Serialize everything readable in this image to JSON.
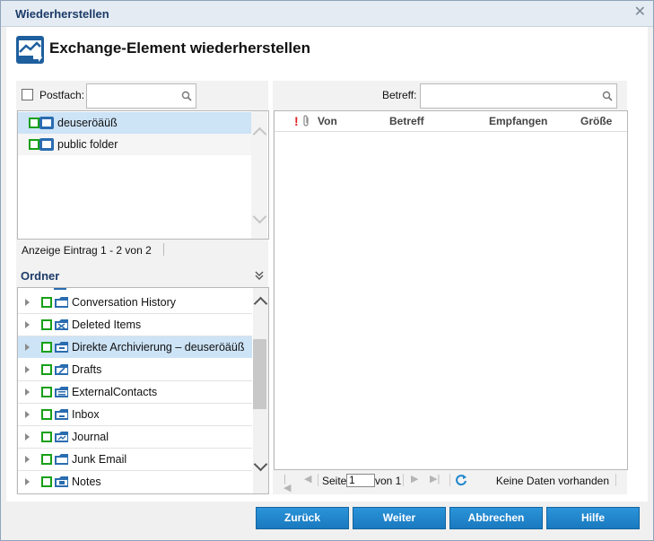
{
  "window": {
    "title": "Wiederherstellen"
  },
  "header": {
    "title": "Exchange-Element wiederherstellen"
  },
  "mailbox_filter": {
    "label": "Postfach:",
    "value": "",
    "placeholder": ""
  },
  "mailboxes": [
    {
      "label": "deuseröäüß",
      "selected": true
    },
    {
      "label": "public folder",
      "selected": false
    }
  ],
  "mailbox_status": "Anzeige Eintrag 1 - 2 von 2",
  "folders_section": {
    "title": "Ordner"
  },
  "folders": [
    {
      "label": "Conversation History",
      "icon": "folder-icon"
    },
    {
      "label": "Deleted Items",
      "icon": "deleted-folder-icon"
    },
    {
      "label": "Direkte Archivierung – deuseröäüß",
      "icon": "archive-folder-icon",
      "selected": true
    },
    {
      "label": "Drafts",
      "icon": "drafts-folder-icon"
    },
    {
      "label": "ExternalContacts",
      "icon": "contacts-folder-icon"
    },
    {
      "label": "Inbox",
      "icon": "inbox-folder-icon"
    },
    {
      "label": "Journal",
      "icon": "journal-folder-icon"
    },
    {
      "label": "Junk Email",
      "icon": "folder-icon"
    },
    {
      "label": "Notes",
      "icon": "notes-folder-icon"
    }
  ],
  "subject_filter": {
    "label": "Betreff:",
    "value": "",
    "placeholder": ""
  },
  "table": {
    "columns": [
      "Von",
      "Betreff",
      "Empfangen",
      "Größe"
    ],
    "rows": []
  },
  "pager": {
    "page_label": "Seite",
    "page_value": "1",
    "of_label": "von 1",
    "empty_text": "Keine Daten vorhanden"
  },
  "buttons": {
    "back": "Zurück",
    "next": "Weiter",
    "cancel": "Abbrechen",
    "help": "Hilfe"
  },
  "colors": {
    "accent": "#1e86cd",
    "title": "#1c3b68",
    "selection": "#cde3f6",
    "status_green": "#16a016"
  }
}
